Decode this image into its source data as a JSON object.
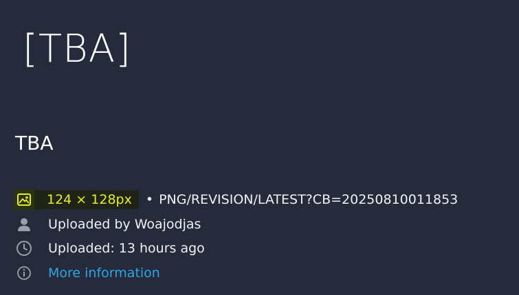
{
  "preview": {
    "image_alt": "[TBA]"
  },
  "file": {
    "title": "TBA"
  },
  "meta": {
    "dimensions": "124 × 128px",
    "separator": "•",
    "path": "PNG/REVISION/LATEST?CB=20250810011853",
    "uploader": "Uploaded by Woajodjas",
    "uploaded_time": "Uploaded: 13 hours ago",
    "more_info": "More information"
  },
  "colors": {
    "background": "#262b3b",
    "highlight_text": "#e6ee2a",
    "link": "#2fa5e6"
  },
  "icons": {
    "dimensions": "image-icon",
    "uploader": "user-icon",
    "uploaded": "clock-icon",
    "more": "info-icon"
  }
}
